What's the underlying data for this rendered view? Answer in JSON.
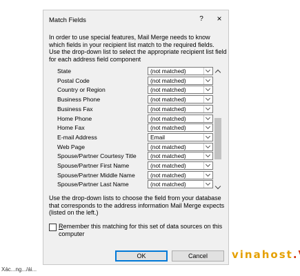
{
  "dialog": {
    "title": "Match Fields",
    "help_glyph": "?",
    "close_glyph": "×",
    "intro_text": "In order to use special features, Mail Merge needs to know which fields in your recipient list match to the required fields. Use the drop-down list to select the appropriate recipient list field for each address field component",
    "fields": [
      {
        "label": "State",
        "value": "(not matched)"
      },
      {
        "label": "Postal Code",
        "value": "(not matched)"
      },
      {
        "label": "Country or Region",
        "value": "(not matched)"
      },
      {
        "label": "Business Phone",
        "value": "(not matched)"
      },
      {
        "label": "Business Fax",
        "value": "(not matched)"
      },
      {
        "label": "Home Phone",
        "value": "(not matched)"
      },
      {
        "label": "Home Fax",
        "value": "(not matched)"
      },
      {
        "label": "E-mail Address",
        "value": "Email"
      },
      {
        "label": "Web Page",
        "value": "(not matched)"
      },
      {
        "label": "Spouse/Partner Courtesy Title",
        "value": "(not matched)"
      },
      {
        "label": "Spouse/Partner First Name",
        "value": "(not matched)"
      },
      {
        "label": "Spouse/Partner Middle Name",
        "value": "(not matched)"
      },
      {
        "label": "Spouse/Partner Last Name",
        "value": "(not matched)"
      }
    ],
    "hint_text": "Use the drop-down lists to choose the field from your database that corresponds to the address information Mail Merge expects (listed on the left.)",
    "remember_access_key": "R",
    "remember_rest": "emember this matching for this set of data sources on this computer",
    "remember_checked": false,
    "ok_label": "OK",
    "cancel_label": "Cancel"
  },
  "watermark": {
    "text": "vinahost",
    "mark": ".V"
  },
  "bottom_text": "Xác...ng.../ái..."
}
